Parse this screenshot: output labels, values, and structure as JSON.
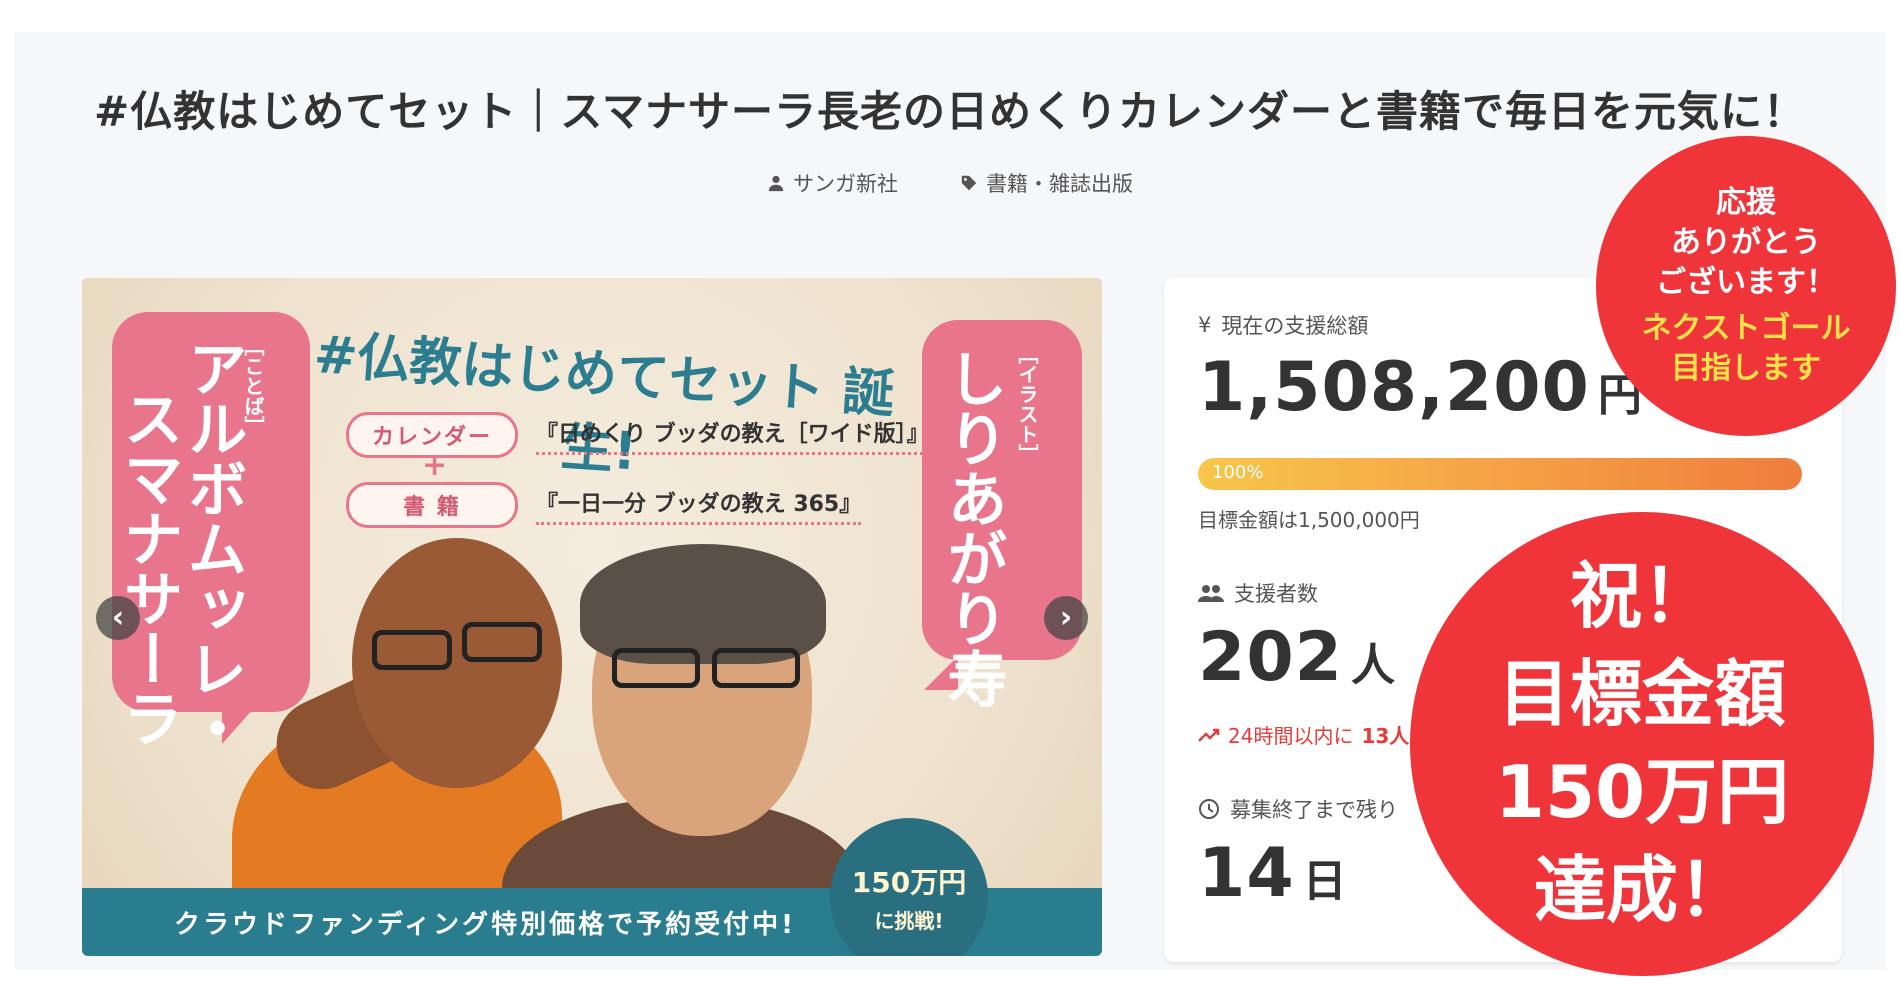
{
  "project": {
    "title": "#仏教はじめてセット｜スマナサーラ長老の日めくりカレンダーと書籍で毎日を元気に！",
    "owner": "サンガ新社",
    "category": "書籍・雑誌出版"
  },
  "hero": {
    "headline": "#仏教はじめてセット 誕生!",
    "left_small": "［ことば］",
    "left_line1": "アルボムッレ・",
    "left_line2": "スマナサーラ",
    "right_small": "［イラスト］",
    "right_name": "しりあがり寿",
    "item1_tag": "カレンダー",
    "item1_name": "『日めくり ブッダの教え［ワイド版］』",
    "plus": "+",
    "item2_tag": "書 籍",
    "item2_name": "『一日一分 ブッダの教え 365』",
    "banner": "クラウドファンディング特別価格で予約受付中!",
    "badge_line1": "150万円",
    "badge_line2": "に挑戦!",
    "prev_icon": "chevron-left-icon",
    "next_icon": "chevron-right-icon"
  },
  "stats": {
    "total_label": "現在の支援総額",
    "total_value": "1,508,200",
    "total_unit": "円",
    "progress_percent": 100,
    "progress_text": "100%",
    "goal_note": "目標金額は1,500,000円",
    "backers_label": "支援者数",
    "backers_value": "202",
    "backers_unit": "人",
    "trend_prefix": "24時間以内に",
    "trend_value": "13人",
    "remaining_label": "募集終了まで残り",
    "remaining_value": "14",
    "remaining_unit": "日"
  },
  "overlay_small": {
    "line1": "応援",
    "line2": "ありがとう",
    "line3": "ございます！",
    "line4": "ネクストゴール",
    "line5": "目指します"
  },
  "overlay_big": {
    "line1": "祝！",
    "line2": "目標金額",
    "line3": "150万円",
    "line4": "達成！"
  },
  "colors": {
    "accent_red": "#f0353a",
    "accent_yellow": "#ffe14a",
    "teal": "#2a7d8f",
    "pink": "#e8758b",
    "progress_start": "#f7c64a",
    "progress_end": "#f07d3c"
  }
}
